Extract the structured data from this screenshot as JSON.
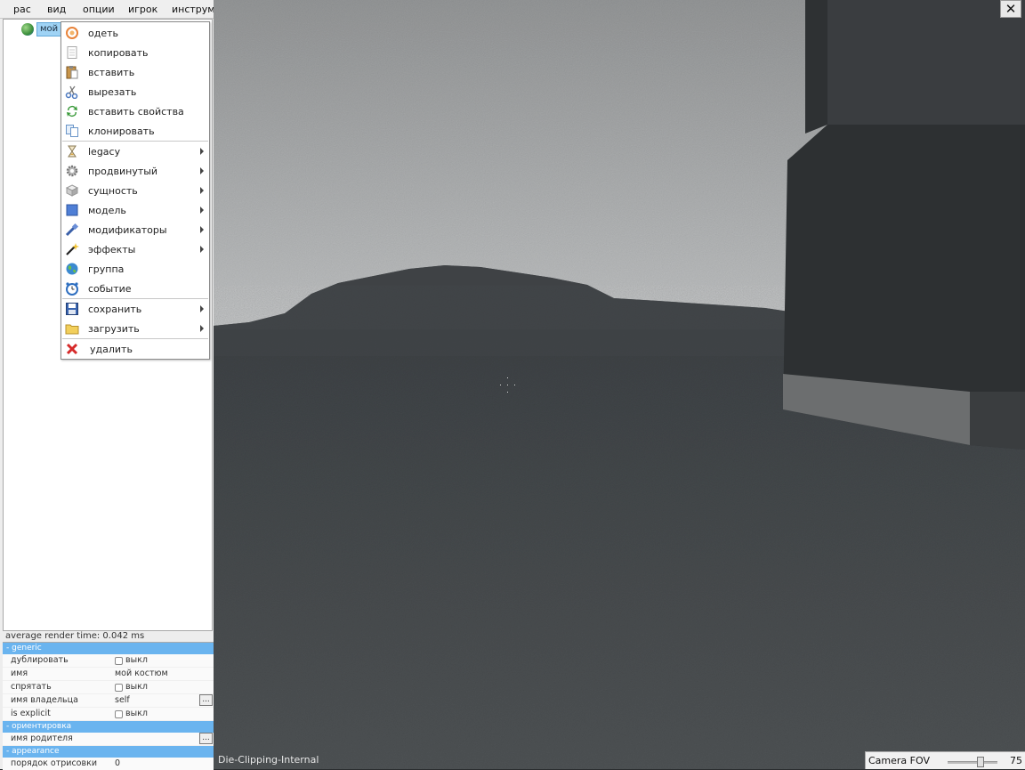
{
  "menubar": {
    "items": [
      "рас",
      "вид",
      "опции",
      "игрок",
      "инструме"
    ]
  },
  "tree": {
    "node_label": "мой к"
  },
  "context_menu": {
    "group1": [
      {
        "label": "одеть",
        "icon": "dress-icon"
      },
      {
        "label": "копировать",
        "icon": "copy-icon"
      },
      {
        "label": "вставить",
        "icon": "paste-icon"
      },
      {
        "label": "вырезать",
        "icon": "scissors-icon"
      },
      {
        "label": "вставить свойства",
        "icon": "paste-properties-icon"
      },
      {
        "label": "клонировать",
        "icon": "clone-icon"
      }
    ],
    "group2": [
      {
        "label": "legacy",
        "icon": "hourglass-icon",
        "submenu": true
      },
      {
        "label": "продвинутый",
        "icon": "gear-icon",
        "submenu": true
      },
      {
        "label": "сущность",
        "icon": "entity-cube-icon",
        "submenu": true
      },
      {
        "label": "модель",
        "icon": "model-square-icon",
        "submenu": true
      },
      {
        "label": "модификаторы",
        "icon": "modifier-brush-icon",
        "submenu": true
      },
      {
        "label": "эффекты",
        "icon": "magic-wand-icon",
        "submenu": true
      },
      {
        "label": "группа",
        "icon": "globe-icon",
        "submenu": false
      },
      {
        "label": "событие",
        "icon": "clock-icon",
        "submenu": false
      }
    ],
    "group3": [
      {
        "label": "сохранить",
        "icon": "floppy-disk-icon",
        "submenu": true
      },
      {
        "label": "загрузить",
        "icon": "folder-icon",
        "submenu": true
      }
    ],
    "group4": [
      {
        "label": "удалить",
        "icon": "delete-x-icon"
      }
    ]
  },
  "status": {
    "render_time": "average render time: 0.042 ms"
  },
  "properties": {
    "sections": [
      {
        "title": "- generic"
      },
      {
        "title": "- ориентировка"
      },
      {
        "title": "- appearance"
      }
    ],
    "generic": [
      {
        "name": "дублировать",
        "value": "выкл",
        "type": "checkbox"
      },
      {
        "name": "имя",
        "value": "мой костюм",
        "type": "text"
      },
      {
        "name": "спрятать",
        "value": "выкл",
        "type": "checkbox"
      },
      {
        "name": "имя владельца",
        "value": "self",
        "type": "text-dots"
      },
      {
        "name": "is explicit",
        "value": "выкл",
        "type": "checkbox"
      }
    ],
    "orientation": [
      {
        "name": "имя родителя",
        "value": "",
        "type": "text-dots"
      }
    ],
    "appearance": [
      {
        "name": "порядок отрисовки",
        "value": "0",
        "type": "text"
      }
    ],
    "dots_label": "..."
  },
  "viewport": {
    "close_label": "✕",
    "clip_label": "Die-Clipping-Internal",
    "fov_label": "Camera FOV",
    "fov_value": "75",
    "fov_fraction": 0.68
  }
}
